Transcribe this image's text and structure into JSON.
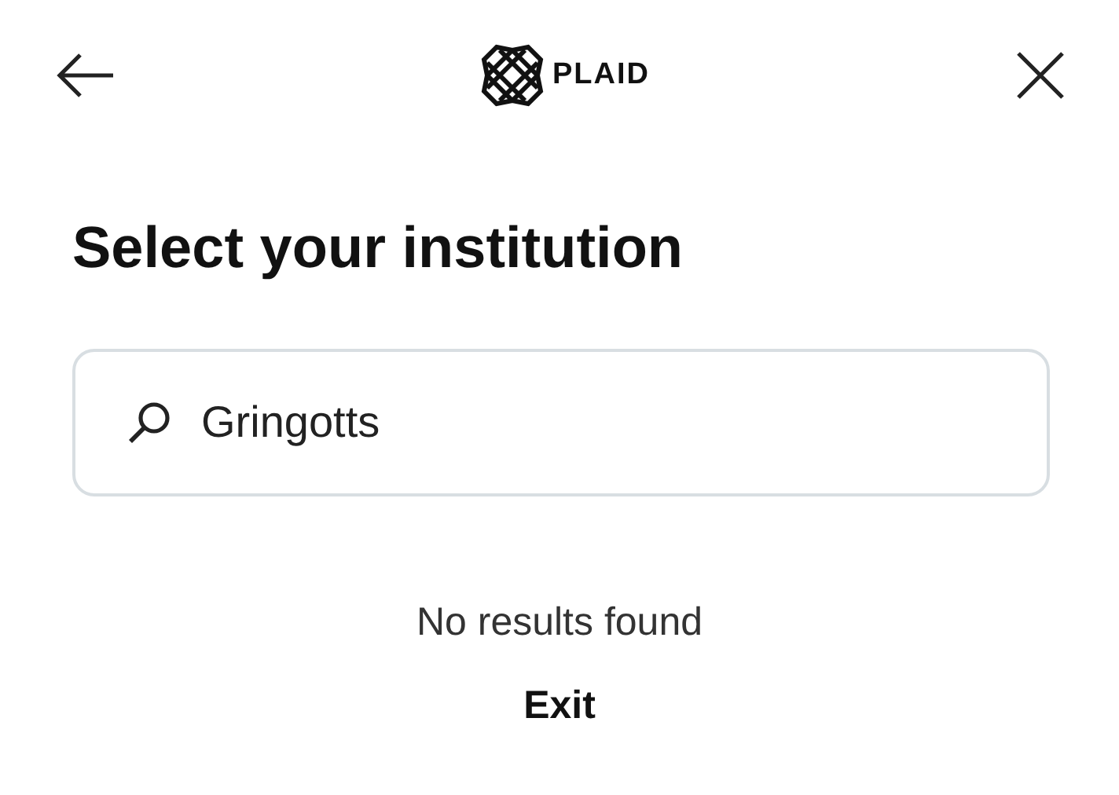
{
  "header": {
    "logo_text": "PLAID"
  },
  "title": "Select your institution",
  "search": {
    "value": "Gringotts"
  },
  "empty_state": {
    "message": "No results found",
    "action": "Exit"
  }
}
